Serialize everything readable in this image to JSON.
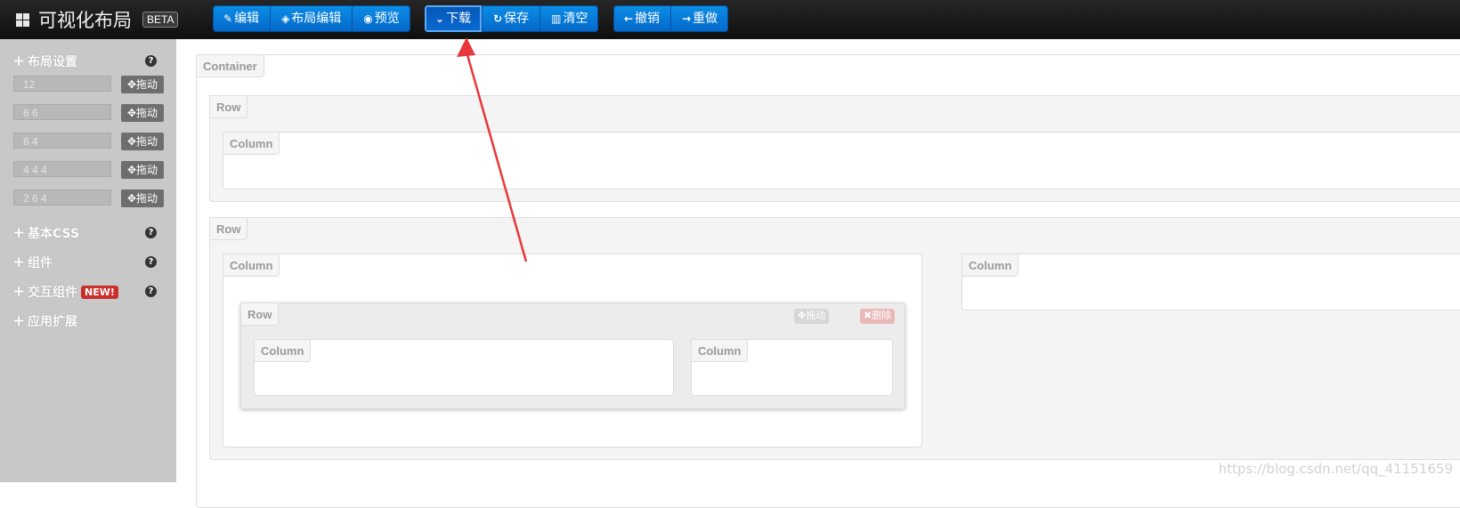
{
  "topbar": {
    "title": "可视化布局",
    "beta": "BETA",
    "group1": [
      {
        "icon": "✎",
        "label": "编辑"
      },
      {
        "icon": "◈",
        "label": "布局编辑"
      },
      {
        "icon": "◉",
        "label": "预览"
      }
    ],
    "group2": [
      {
        "icon": "⌄",
        "label": "下载"
      },
      {
        "icon": "↻",
        "label": "保存"
      },
      {
        "icon": "▥",
        "label": "清空"
      }
    ],
    "group3": [
      {
        "icon": "←",
        "label": "撤销"
      },
      {
        "icon": "→",
        "label": "重做"
      }
    ]
  },
  "sidebar": {
    "layout_settings": "布局设置",
    "grids": [
      {
        "value": "12",
        "drag": "拖动"
      },
      {
        "value": "6 6",
        "drag": "拖动"
      },
      {
        "value": "8 4",
        "drag": "拖动"
      },
      {
        "value": "4 4 4",
        "drag": "拖动"
      },
      {
        "value": "2 6 4",
        "drag": "拖动"
      }
    ],
    "basic_css": "基本CSS",
    "components": "组件",
    "interactive": "交互组件",
    "new_badge": "NEW!",
    "extensions": "应用扩展",
    "help": "?"
  },
  "canvas": {
    "container_label": "Container",
    "row_label": "Row",
    "column_label": "Column",
    "drag_label": "拖动",
    "delete_label": "删除"
  },
  "watermark": "https://blog.csdn.net/qq_41151659",
  "colors": {
    "accent": "#0567c9",
    "arrow": "#e8373a"
  }
}
